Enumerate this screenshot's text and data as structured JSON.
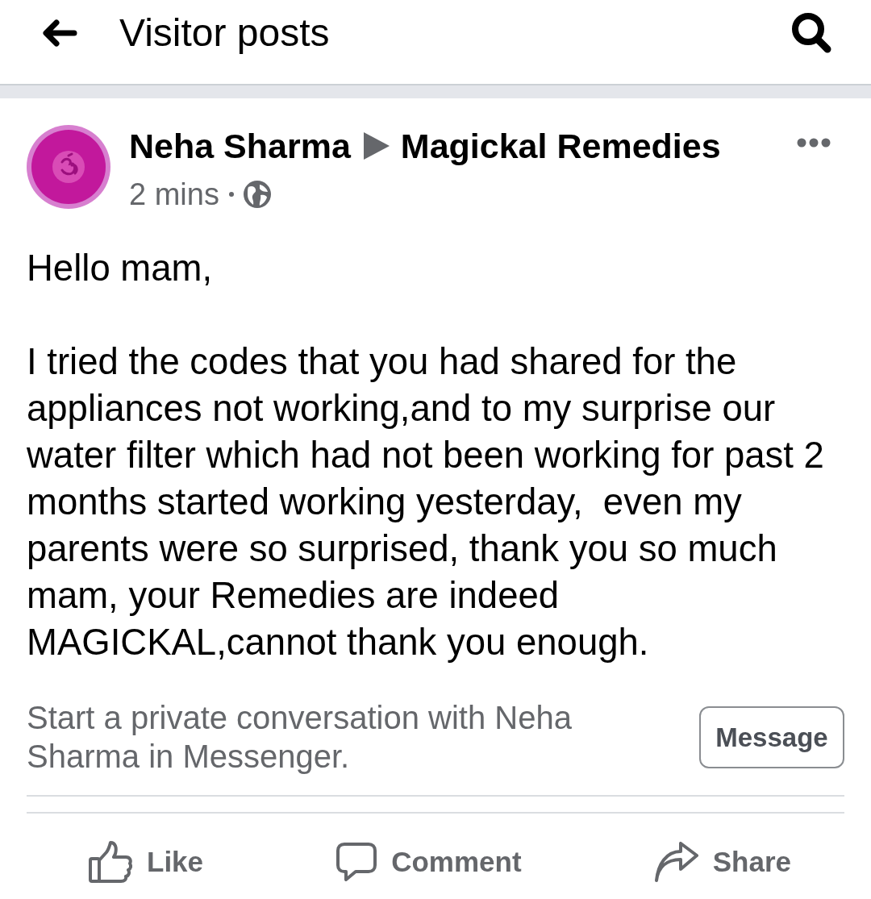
{
  "header": {
    "title": "Visitor posts"
  },
  "post": {
    "author": "Neha Sharma",
    "target": "Magickal Remedies",
    "time": "2 mins",
    "public": true,
    "body": [
      "Hello mam,",
      "I tried the codes that you had shared for the appliances not working,and to my surprise our water filter which had not been working for past 2 months started working yesterday,  even my parents were so surprised, thank you so much mam, your Remedies are indeed MAGICKAL,cannot thank you enough."
    ],
    "messenger_prompt": {
      "text": "Start a private conversation with Neha Sharma in Messenger.",
      "button": "Message"
    },
    "actions": [
      {
        "kind": "like",
        "label": "Like"
      },
      {
        "kind": "comment",
        "label": "Comment"
      },
      {
        "kind": "share",
        "label": "Share"
      }
    ]
  }
}
